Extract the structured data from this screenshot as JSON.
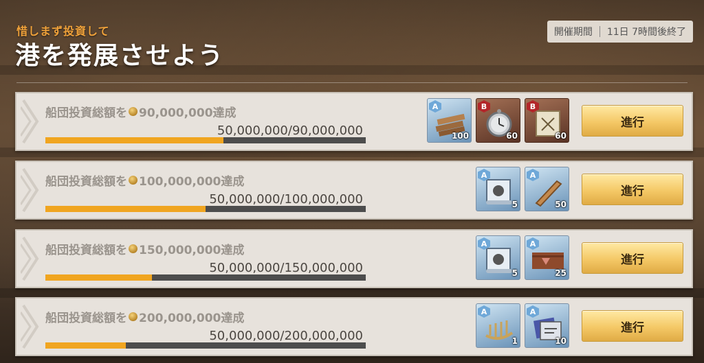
{
  "header": {
    "subtitle": "惜しまず投資して",
    "title": "港を発展させよう",
    "period_label": "開催期間",
    "period_value": "11日 7時間後終了"
  },
  "rows": [
    {
      "goal_prefix": "船団投資総額を",
      "goal_amount": "90,000,000達成",
      "progress_text": "50,000,000/90,000,000",
      "progress_fraction": 0.556,
      "rewards": [
        {
          "icon": "wood-planks-icon",
          "grade": "A",
          "quantity": "100",
          "color": "blue"
        },
        {
          "icon": "pocket-watch-icon",
          "grade": "B",
          "quantity": "60",
          "color": "brown"
        },
        {
          "icon": "map-scroll-icon",
          "grade": "B",
          "quantity": "60",
          "color": "brown"
        }
      ],
      "button_label": "進行"
    },
    {
      "goal_prefix": "船団投資総額を",
      "goal_amount": "100,000,000達成",
      "progress_text": "50,000,000/100,000,000",
      "progress_fraction": 0.5,
      "rewards": [
        {
          "icon": "blueprint-icon",
          "grade": "A",
          "quantity": "5",
          "color": "blue"
        },
        {
          "icon": "mast-icon",
          "grade": "A",
          "quantity": "50",
          "color": "blue"
        }
      ],
      "button_label": "進行"
    },
    {
      "goal_prefix": "船団投資総額を",
      "goal_amount": "150,000,000達成",
      "progress_text": "50,000,000/150,000,000",
      "progress_fraction": 0.333,
      "rewards": [
        {
          "icon": "blueprint-icon",
          "grade": "A",
          "quantity": "5",
          "color": "blue"
        },
        {
          "icon": "hull-plank-icon",
          "grade": "A",
          "quantity": "25",
          "color": "blue"
        }
      ],
      "button_label": "進行"
    },
    {
      "goal_prefix": "船団投資総額を",
      "goal_amount": "200,000,000達成",
      "progress_text": "50,000,000/200,000,000",
      "progress_fraction": 0.25,
      "rewards": [
        {
          "icon": "ship-frame-icon",
          "grade": "A",
          "quantity": "1",
          "color": "blue"
        },
        {
          "icon": "blueprint-bundle-icon",
          "grade": "A",
          "quantity": "10",
          "color": "blue"
        }
      ],
      "button_label": "進行"
    }
  ]
}
